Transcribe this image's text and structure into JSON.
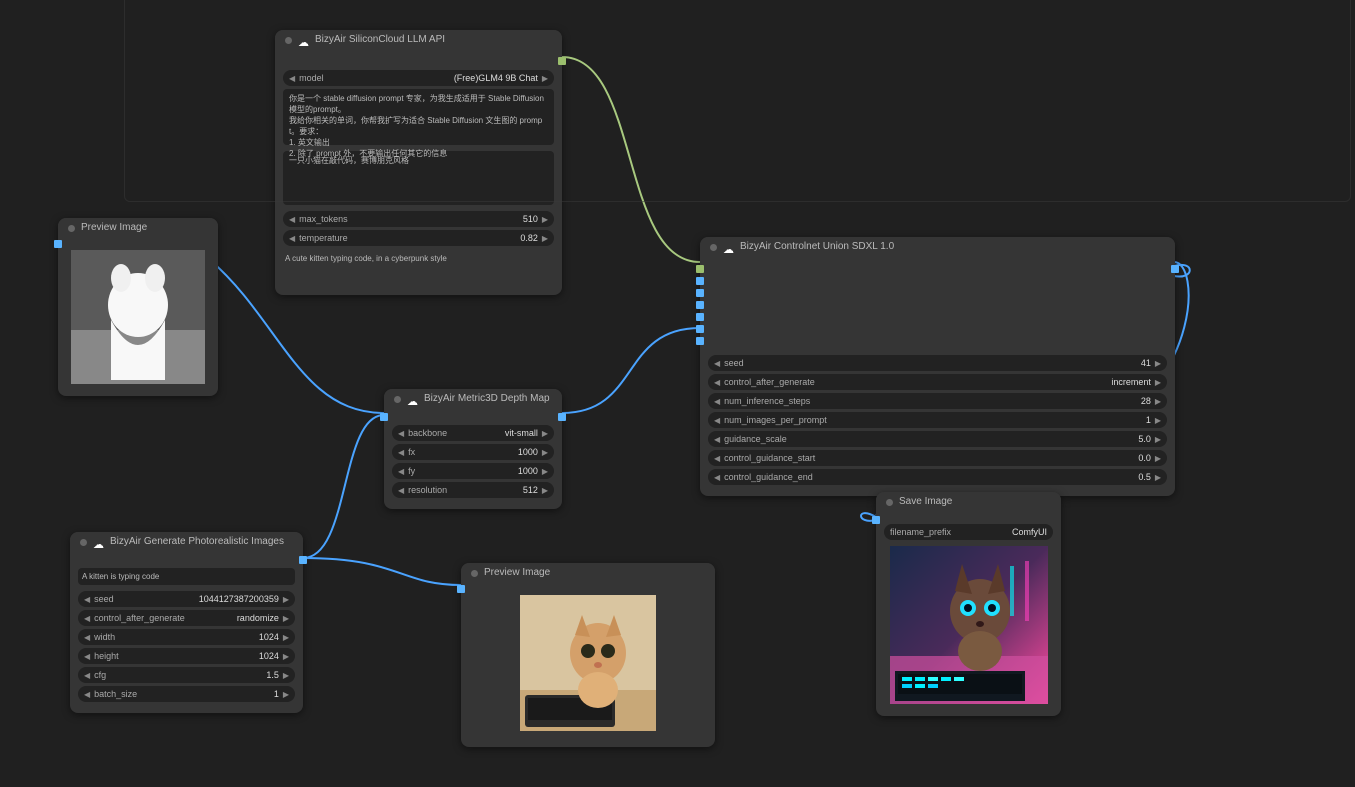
{
  "nodes": {
    "llm": {
      "title": "BizyAir SiliconCloud LLM API",
      "model_label": "model",
      "model_value": "(Free)GLM4 9B Chat",
      "system_prompt": "你是一个 stable diffusion prompt 专家，为我生成适用于 Stable Diffusion 模型的prompt。\n我给你相关的单词，你帮我扩写为适合 Stable Diffusion 文生图的 prompt。要求：\n1. 英文输出\n2. 除了 prompt 外，不要输出任何其它的信息",
      "user_prompt": "一只小猫在敲代码，赛博朋克风格",
      "max_tokens_label": "max_tokens",
      "max_tokens_value": "510",
      "temperature_label": "temperature",
      "temperature_value": "0.82",
      "output_text": "A cute kitten typing code, in a cyberpunk style"
    },
    "preview1": {
      "title": "Preview Image"
    },
    "depth": {
      "title": "BizyAir Metric3D Depth Map",
      "backbone_label": "backbone",
      "backbone_value": "vit-small",
      "fx_label": "fx",
      "fx_value": "1000",
      "fy_label": "fy",
      "fy_value": "1000",
      "resolution_label": "resolution",
      "resolution_value": "512"
    },
    "gen": {
      "title": "BizyAir Generate Photorealistic Images",
      "prompt": "A kitten is typing code",
      "seed_label": "seed",
      "seed_value": "1044127387200359",
      "cag_label": "control_after_generate",
      "cag_value": "randomize",
      "width_label": "width",
      "width_value": "1024",
      "height_label": "height",
      "height_value": "1024",
      "cfg_label": "cfg",
      "cfg_value": "1.5",
      "batch_label": "batch_size",
      "batch_value": "1"
    },
    "preview2": {
      "title": "Preview Image"
    },
    "controlnet": {
      "title": "BizyAir Controlnet Union SDXL 1.0",
      "seed_label": "seed",
      "seed_value": "41",
      "cag_label": "control_after_generate",
      "cag_value": "increment",
      "steps_label": "num_inference_steps",
      "steps_value": "28",
      "nipp_label": "num_images_per_prompt",
      "nipp_value": "1",
      "gs_label": "guidance_scale",
      "gs_value": "5.0",
      "cgs_label": "control_guidance_start",
      "cgs_value": "0.0",
      "cge_label": "control_guidance_end",
      "cge_value": "0.5"
    },
    "save": {
      "title": "Save Image",
      "prefix_label": "filename_prefix",
      "prefix_value": "ComfyUI"
    }
  },
  "colors": {
    "wire_img": "#4aa3ff",
    "wire_txt": "#a8c97f",
    "port_img": "#59b3ff",
    "port_txt": "#9bbf6d"
  }
}
